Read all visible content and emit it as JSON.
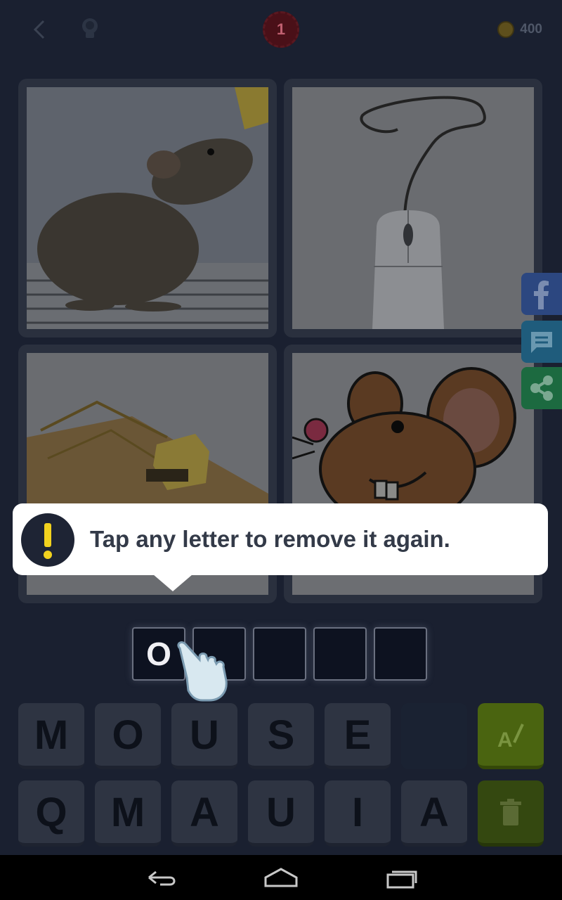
{
  "header": {
    "level": "1",
    "coins": "400"
  },
  "tooltip": {
    "text": "Tap any letter to remove it again."
  },
  "answer": {
    "slots": [
      "O",
      "",
      "",
      "",
      ""
    ]
  },
  "keyboard": {
    "row1": [
      "M",
      "O",
      "U",
      "S",
      "E",
      ""
    ],
    "row2": [
      "Q",
      "M",
      "A",
      "U",
      "I",
      "A"
    ]
  },
  "icons": {
    "back": "back-arrow-icon",
    "hint": "lightbulb-icon",
    "coin": "coin-icon",
    "facebook": "facebook-icon",
    "message": "chat-bubble-icon",
    "share": "share-icon",
    "alert": "exclamation-icon",
    "reveal": "reveal-letter-icon",
    "remove": "trash-icon"
  }
}
